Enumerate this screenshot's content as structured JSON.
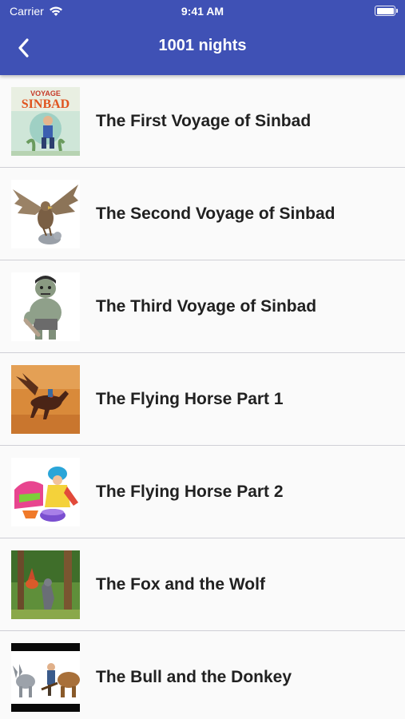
{
  "status_bar": {
    "carrier": "Carrier",
    "time": "9:41 AM"
  },
  "header": {
    "title": "1001 nights",
    "back_icon": "chevron-left-icon",
    "background_color": "#3f51b5"
  },
  "stories": [
    {
      "title": "The First Voyage of Sinbad",
      "thumbnail": "sinbad-book-cover",
      "thumbnail_text": [
        "VOYAGE",
        "SINBAD"
      ]
    },
    {
      "title": "The Second Voyage of Sinbad",
      "thumbnail": "giant-bird-carrying-animal"
    },
    {
      "title": "The Third Voyage of Sinbad",
      "thumbnail": "ogre-cartoon"
    },
    {
      "title": "The Flying Horse Part 1",
      "thumbnail": "winged-horse-painting"
    },
    {
      "title": "The Flying Horse Part 2",
      "thumbnail": "colorful-figure-painting"
    },
    {
      "title": "The Fox and the Wolf",
      "thumbnail": "wolf-in-forest"
    },
    {
      "title": "The Bull and the Donkey",
      "thumbnail": "donkey-and-bull-plowing"
    }
  ]
}
